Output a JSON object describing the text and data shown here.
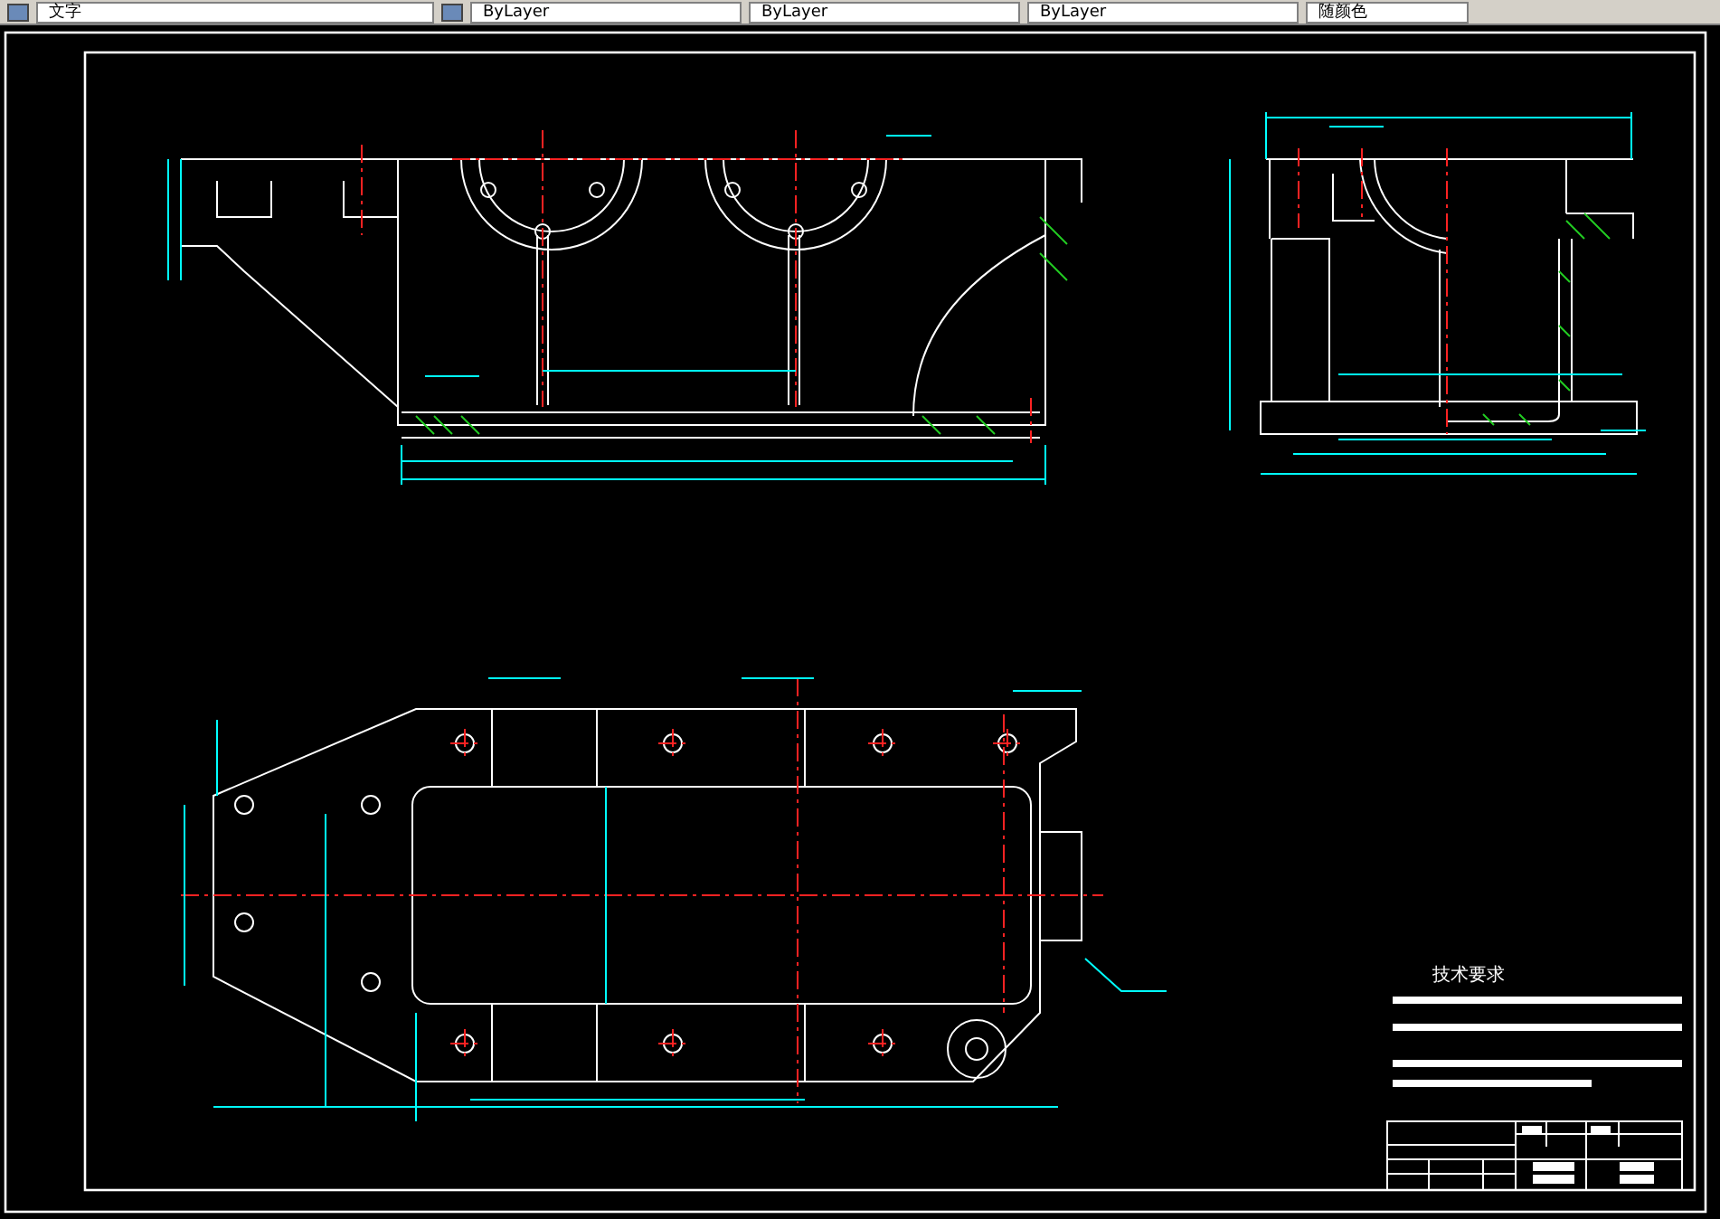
{
  "toolbar": {
    "text_style": "文字",
    "properties": [
      "ByLayer",
      "ByLayer",
      "ByLayer"
    ],
    "plot_style": "随颜色"
  },
  "drawing": {
    "notes_title": "技术要求"
  }
}
